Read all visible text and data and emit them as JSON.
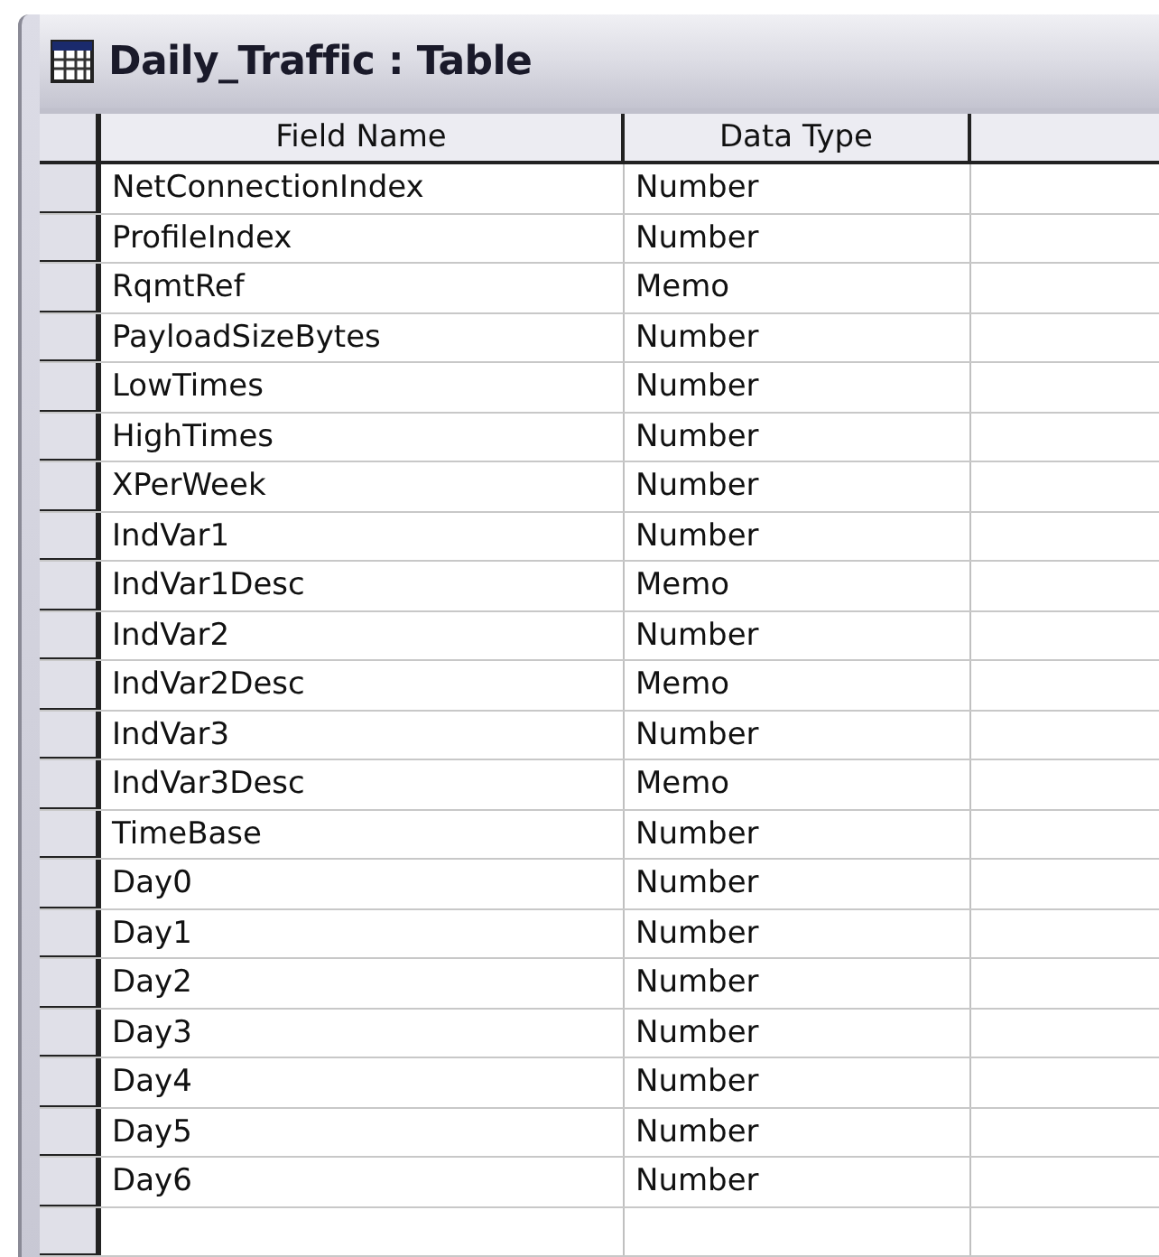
{
  "window": {
    "title": "Daily_Traffic : Table"
  },
  "table": {
    "columns": [
      "Field Name",
      "Data Type"
    ],
    "rows": [
      [
        "NetConnectionIndex",
        "Number"
      ],
      [
        "ProfileIndex",
        "Number"
      ],
      [
        "RqmtRef",
        "Memo"
      ],
      [
        "PayloadSizeBytes",
        "Number"
      ],
      [
        "LowTimes",
        "Number"
      ],
      [
        "HighTimes",
        "Number"
      ],
      [
        "XPerWeek",
        "Number"
      ],
      [
        "IndVar1",
        "Number"
      ],
      [
        "IndVar1Desc",
        "Memo"
      ],
      [
        "IndVar2",
        "Number"
      ],
      [
        "IndVar2Desc",
        "Memo"
      ],
      [
        "IndVar3",
        "Number"
      ],
      [
        "IndVar3Desc",
        "Memo"
      ],
      [
        "TimeBase",
        "Number"
      ],
      [
        "Day0",
        "Number"
      ],
      [
        "Day1",
        "Number"
      ],
      [
        "Day2",
        "Number"
      ],
      [
        "Day3",
        "Number"
      ],
      [
        "Day4",
        "Number"
      ],
      [
        "Day5",
        "Number"
      ],
      [
        "Day6",
        "Number"
      ]
    ]
  }
}
